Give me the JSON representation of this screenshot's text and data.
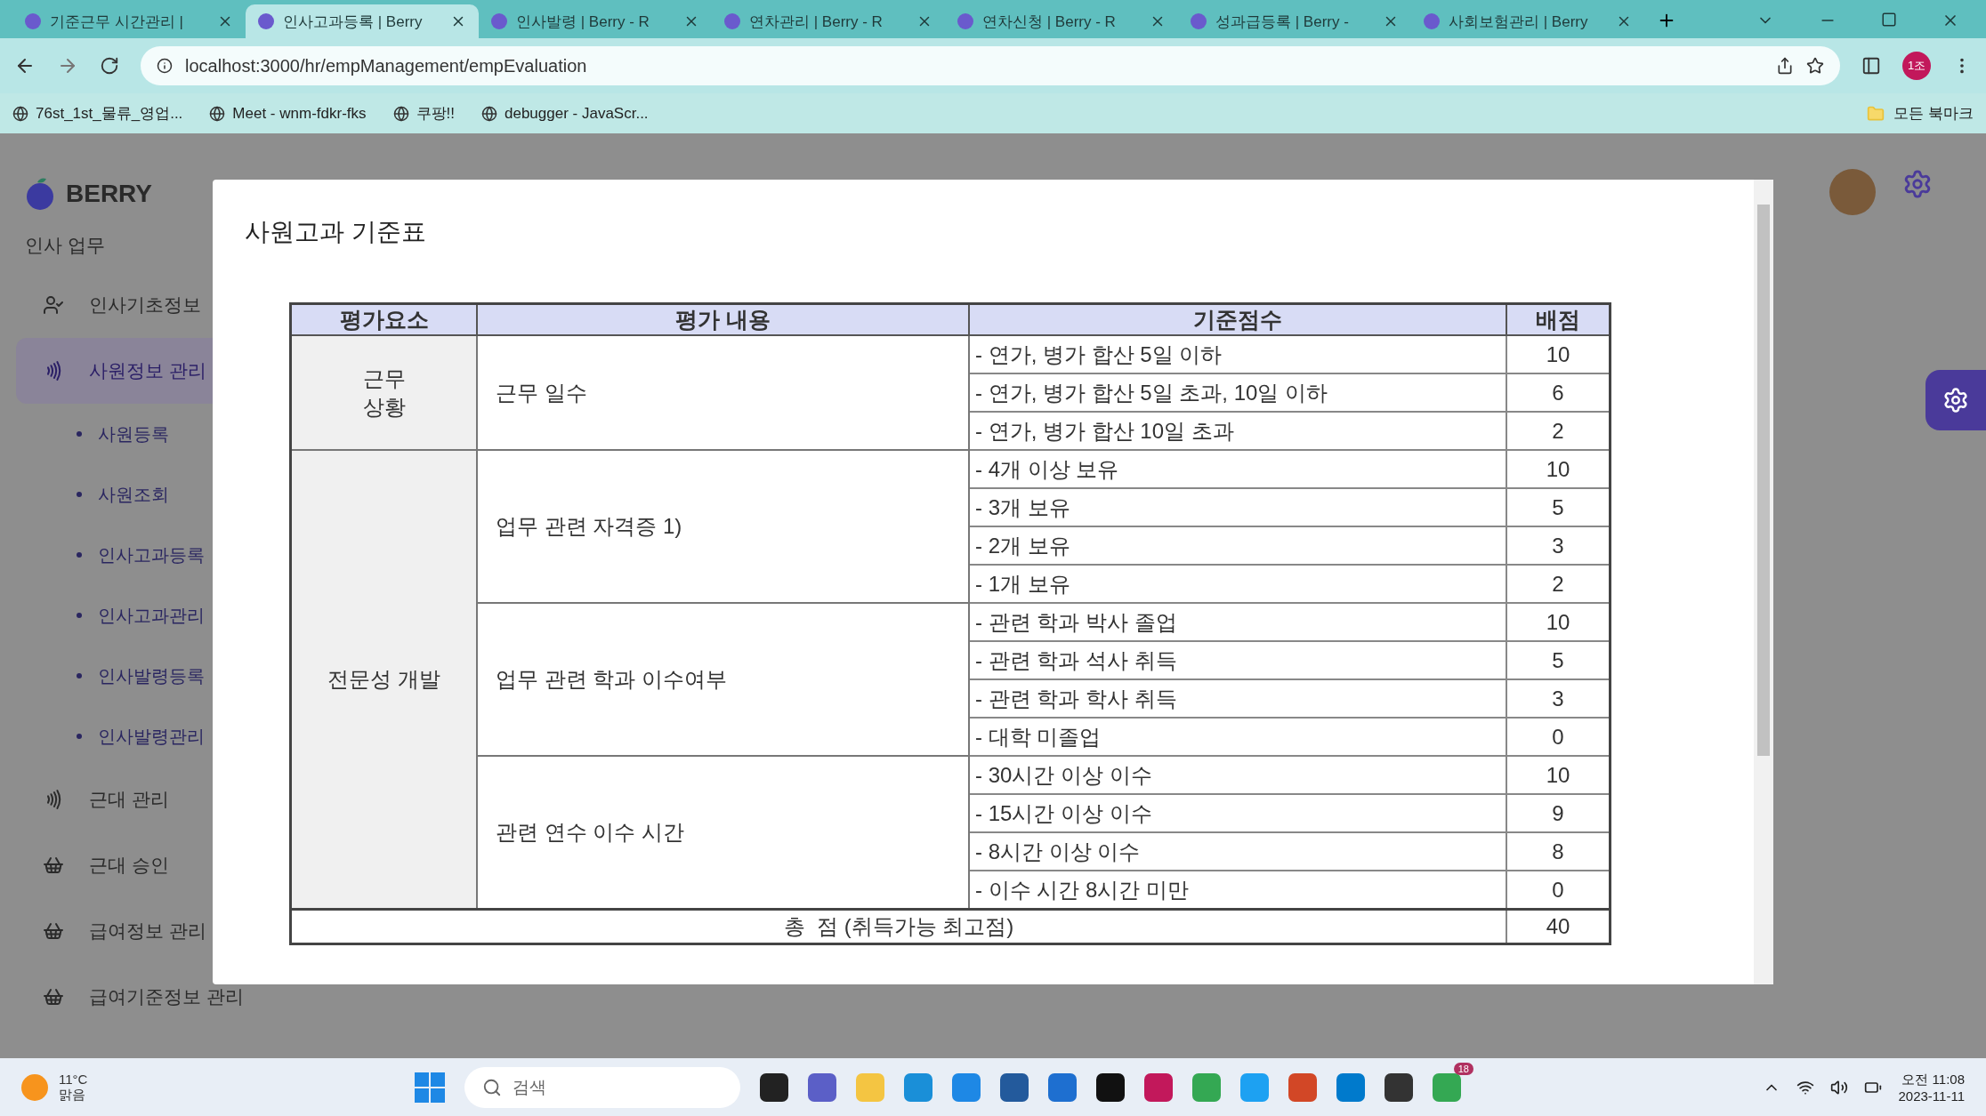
{
  "browser": {
    "tabs": [
      {
        "title": "기준근무 시간관리 |",
        "selected": false
      },
      {
        "title": "인사고과등록 | Berry",
        "selected": true
      },
      {
        "title": "인사발령 | Berry - R",
        "selected": false
      },
      {
        "title": "연차관리 | Berry - R",
        "selected": false
      },
      {
        "title": "연차신청 | Berry - R",
        "selected": false
      },
      {
        "title": "성과급등록 | Berry -",
        "selected": false
      },
      {
        "title": "사회보험관리 | Berry",
        "selected": false
      }
    ],
    "url": "localhost:3000/hr/empManagement/empEvaluation",
    "profile": "1조",
    "bookmarks": [
      {
        "label": "76st_1st_물류_영업..."
      },
      {
        "label": "Meet - wnm-fdkr-fks"
      },
      {
        "label": "쿠팡!!"
      },
      {
        "label": "debugger - JavaScr..."
      }
    ],
    "bookmarks_folder": "모든 북마크"
  },
  "sidebar": {
    "logo": "BERRY",
    "section": "인사 업무",
    "items": [
      {
        "label": "인사기초정보",
        "selected": false
      },
      {
        "label": "사원정보 관리",
        "selected": true,
        "children": [
          {
            "label": "사원등록"
          },
          {
            "label": "사원조회"
          },
          {
            "label": "인사고과등록"
          },
          {
            "label": "인사고과관리"
          },
          {
            "label": "인사발령등록"
          },
          {
            "label": "인사발령관리"
          }
        ]
      },
      {
        "label": "근대 관리",
        "selected": false
      },
      {
        "label": "근대 승인",
        "selected": false
      },
      {
        "label": "급여정보 관리",
        "selected": false
      },
      {
        "label": "급여기준정보 관리",
        "selected": false
      }
    ]
  },
  "modal": {
    "title": "사원고과 기준표",
    "table": {
      "columns": [
        "평가요소",
        "평가 내용",
        "기준점수",
        "배점"
      ],
      "groups": [
        {
          "element": "근무\n상황",
          "items": [
            {
              "content": "근무 일수",
              "criteria": [
                {
                  "text": "- 연가, 병가 합산 5일 이하",
                  "score": "10"
                },
                {
                  "text": "- 연가, 병가 합산 5일 초과, 10일 이하",
                  "score": "6"
                },
                {
                  "text": "- 연가, 병가 합산 10일 초과",
                  "score": "2"
                }
              ]
            }
          ]
        },
        {
          "element": "전문성 개발",
          "items": [
            {
              "content": "업무 관련 자격증 1)",
              "criteria": [
                {
                  "text": "- 4개 이상 보유",
                  "score": "10"
                },
                {
                  "text": "- 3개 보유",
                  "score": "5"
                },
                {
                  "text": "- 2개 보유",
                  "score": "3"
                },
                {
                  "text": "- 1개 보유",
                  "score": "2"
                }
              ]
            },
            {
              "content": "업무 관련 학과 이수여부",
              "criteria": [
                {
                  "text": "- 관련 학과 박사 졸업",
                  "score": "10"
                },
                {
                  "text": "- 관련 학과 석사 취득",
                  "score": "5"
                },
                {
                  "text": "- 관련 학과 학사 취득",
                  "score": "3"
                },
                {
                  "text": "- 대학 미졸업",
                  "score": "0"
                }
              ]
            },
            {
              "content": "관련 연수 이수 시간",
              "criteria": [
                {
                  "text": "- 30시간 이상 이수",
                  "score": "10"
                },
                {
                  "text": "- 15시간 이상 이수",
                  "score": "9"
                },
                {
                  "text": "- 8시간 이상 이수",
                  "score": "8"
                },
                {
                  "text": "- 이수 시간 8시간 미만",
                  "score": "0"
                }
              ]
            }
          ]
        }
      ],
      "total": {
        "label": "총  점 (취득가능 최고점)",
        "score": "40"
      }
    }
  },
  "taskbar": {
    "temperature": "11°C",
    "weather": "맑음",
    "search_placeholder": "검색",
    "time": "오전 11:08",
    "date": "2023-11-11",
    "notification_count": "18"
  }
}
